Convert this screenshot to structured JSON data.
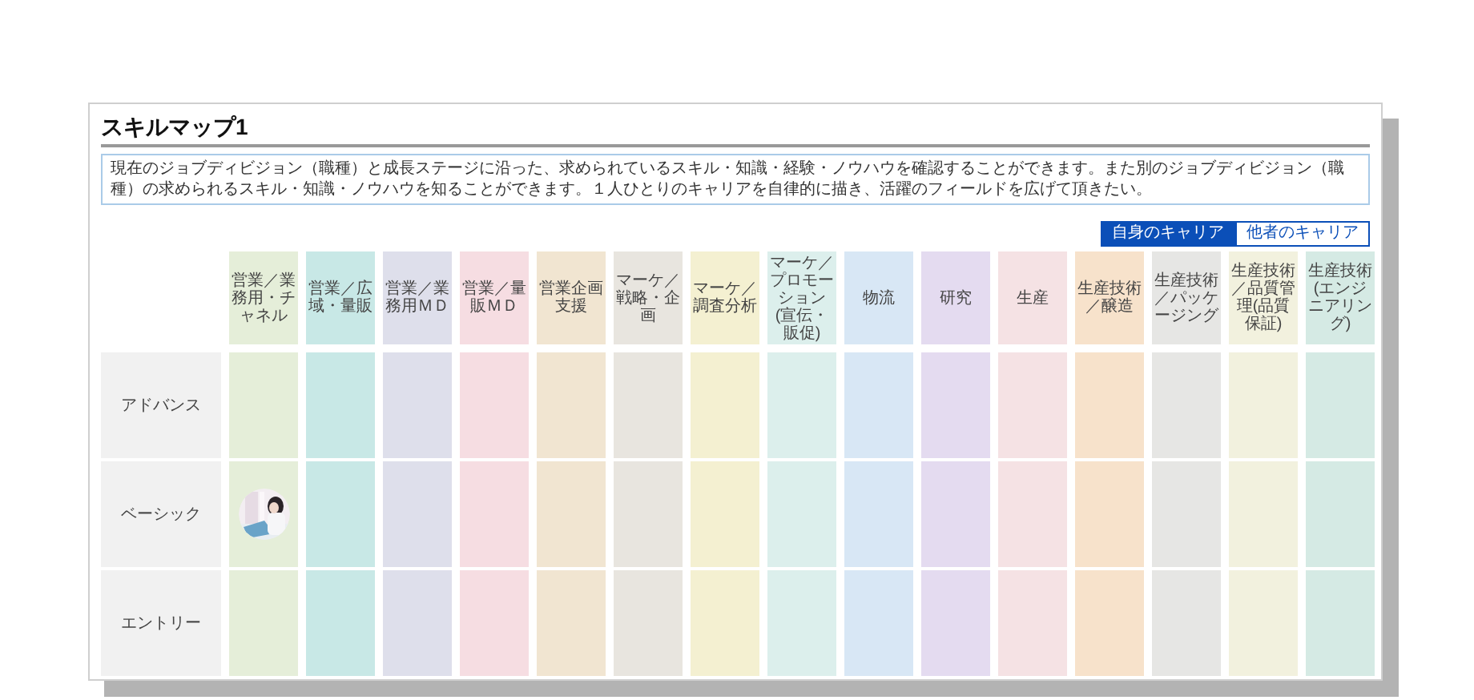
{
  "title": "スキルマップ1",
  "description": "現在のジョブディビジョン（職種）と成長ステージに沿った、求められているスキル・知識・経験・ノウハウを確認することができます。また別のジョブディビジョン（職種）の求められるスキル・知識・ノウハウを知ることができます。１人ひとりのキャリアを自律的に描き、活躍のフィールドを広げて頂きたい。",
  "tabs": [
    {
      "label": "自身のキャリア",
      "selected": true
    },
    {
      "label": "他者のキャリア",
      "selected": false
    }
  ],
  "columns": [
    {
      "label": "営業／業務用・チャネル",
      "color": "#e5eed9"
    },
    {
      "label": "営業／広域・量販",
      "color": "#c8e8e6"
    },
    {
      "label": "営業／業務用ＭＤ",
      "color": "#dedfeb"
    },
    {
      "label": "営業／量販ＭＤ",
      "color": "#f6dde2"
    },
    {
      "label": "営業企画支援",
      "color": "#f1e5d1"
    },
    {
      "label": "マーケ／戦略・企画",
      "color": "#e8e5df"
    },
    {
      "label": "マーケ／調査分析",
      "color": "#f4f0d1"
    },
    {
      "label": "マーケ／プロモーション(宣伝・販促)",
      "color": "#dcefec"
    },
    {
      "label": "物流",
      "color": "#d8e7f5"
    },
    {
      "label": "研究",
      "color": "#e4dbf0"
    },
    {
      "label": "生産",
      "color": "#f5e2e4"
    },
    {
      "label": "生産技術／醸造",
      "color": "#f7e2cb"
    },
    {
      "label": "生産技術／パッケージング",
      "color": "#e6e6e4"
    },
    {
      "label": "生産技術／品質管理(品質保証)",
      "color": "#f2f1de"
    },
    {
      "label": "生産技術(エンジニアリング)",
      "color": "#d5eae4"
    }
  ],
  "rows": [
    {
      "label": "アドバンス",
      "cells": [
        {
          "kind": "empty"
        },
        {
          "kind": "empty"
        },
        {
          "kind": "empty"
        },
        {
          "kind": "empty"
        },
        {
          "kind": "empty"
        },
        {
          "kind": "empty"
        },
        {
          "kind": "empty"
        },
        {
          "kind": "empty"
        },
        {
          "kind": "empty"
        },
        {
          "kind": "empty"
        },
        {
          "kind": "empty"
        },
        {
          "kind": "empty"
        },
        {
          "kind": "empty"
        },
        {
          "kind": "empty"
        },
        {
          "kind": "empty"
        }
      ]
    },
    {
      "label": "ベーシック",
      "cells": [
        {
          "kind": "picture"
        },
        {
          "kind": "empty"
        },
        {
          "kind": "empty"
        },
        {
          "kind": "empty"
        },
        {
          "kind": "empty"
        },
        {
          "kind": "empty"
        },
        {
          "kind": "empty"
        },
        {
          "kind": "empty"
        },
        {
          "kind": "empty"
        },
        {
          "kind": "empty"
        },
        {
          "kind": "empty"
        },
        {
          "kind": "empty"
        },
        {
          "kind": "empty"
        },
        {
          "kind": "empty"
        },
        {
          "kind": "empty"
        }
      ]
    },
    {
      "label": "エントリー",
      "cells": [
        {
          "kind": "empty"
        },
        {
          "kind": "empty"
        },
        {
          "kind": "empty"
        },
        {
          "kind": "empty"
        },
        {
          "kind": "empty"
        },
        {
          "kind": "empty"
        },
        {
          "kind": "empty"
        },
        {
          "kind": "empty"
        },
        {
          "kind": "empty"
        },
        {
          "kind": "empty"
        },
        {
          "kind": "empty"
        },
        {
          "kind": "empty"
        },
        {
          "kind": "empty"
        },
        {
          "kind": "empty"
        },
        {
          "kind": "empty"
        }
      ]
    }
  ]
}
